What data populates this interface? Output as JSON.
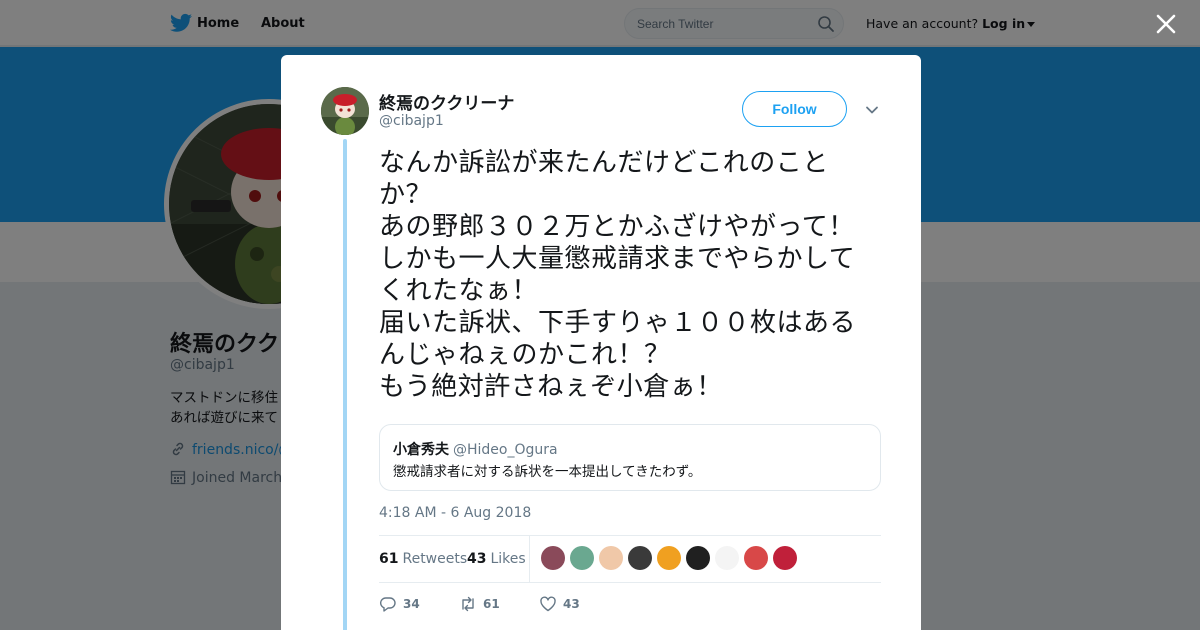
{
  "nav": {
    "home_label": "Home",
    "about_label": "About",
    "search_placeholder": "Search Twitter",
    "account_prompt": "Have an account?",
    "login_label": "Log in",
    "icons": {
      "logo": "twitter-bird-icon",
      "search": "search-icon",
      "close": "close-icon"
    }
  },
  "profile": {
    "name": "終焉のククリーナ",
    "handle": "@cibajp1",
    "bio_lines": [
      "マストドンに移住",
      "あれば遊びに来て"
    ],
    "link": "friends.nico/@",
    "joined": "Joined March"
  },
  "tweet": {
    "author_name": "終焉のククリーナ",
    "author_handle": "@cibajp1",
    "follow_label": "Follow",
    "text": "なんか訴訟が来たんだけどこれのこと\nか？\nあの野郎３０２万とかふざけやがって！\nしかも一人大量懲戒請求までやらかして\nくれたなぁ！\n届いた訴状、下手すりゃ１００枚はある\nんじゃねぇのかこれ！？\nもう絶対許さねぇぞ小倉ぁ！",
    "quote": {
      "author_name": "小倉秀夫",
      "author_handle": "@Hideo_Ogura",
      "text": "懲戒請求者に対する訴状を一本提出してきたわず。"
    },
    "timestamp": "4:18 AM - 6 Aug 2018",
    "stats": {
      "retweets_count": "61",
      "retweets_label": "Retweets",
      "likes_count": "43",
      "likes_label": "Likes"
    },
    "liker_avatars": [
      "#8a4a5a",
      "#6aa890",
      "#f0c8a8",
      "#3a3a3a",
      "#f0a020",
      "#202020",
      "#f4f4f4",
      "#d84848",
      "#c0203a"
    ],
    "actions": {
      "reply_count": "34",
      "retweet_count": "61",
      "like_count": "43"
    }
  },
  "colors": {
    "accent": "#1da1f2",
    "thread_line": "#a3d6f5",
    "text_primary": "#14171a",
    "text_secondary": "#657786"
  }
}
